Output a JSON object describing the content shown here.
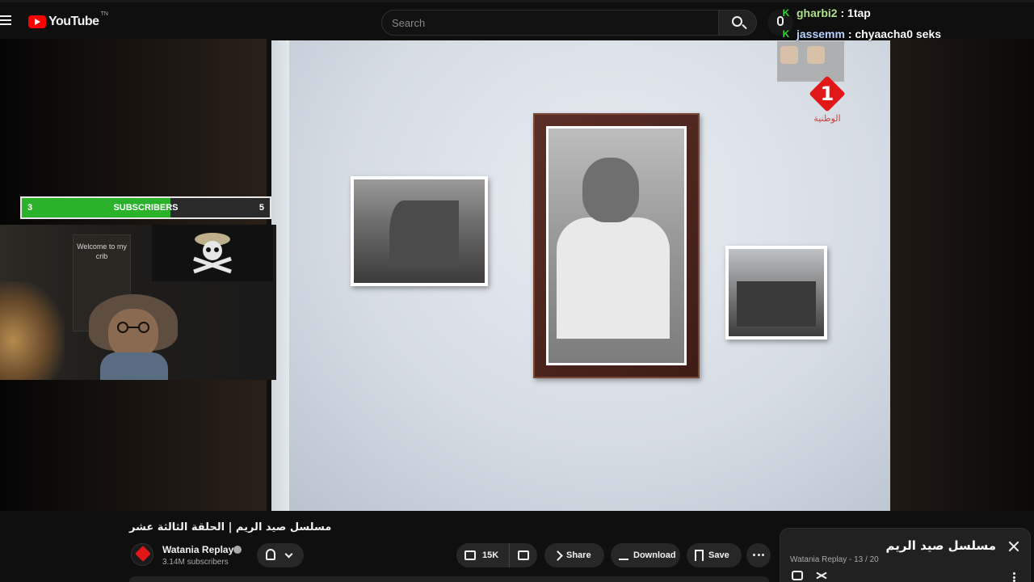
{
  "header": {
    "logo_text": "YouTube",
    "logo_tm": "TN",
    "search_placeholder": "Search"
  },
  "chat": {
    "messages": [
      {
        "user": "gharbi2",
        "sep": " : ",
        "text": "1tap"
      },
      {
        "user": "jassemm",
        "sep": " : ",
        "text": "chyaacha0 seks"
      }
    ]
  },
  "subscriber_bar": {
    "current": "3",
    "label": "SUBSCRIBERS",
    "goal": "5",
    "progress_fraction": 0.6
  },
  "webcam": {
    "poster_text": "Welcome to my crib"
  },
  "tv_overlay": {
    "channel_number": "1",
    "channel_caption": "الوطنية"
  },
  "video": {
    "title": "مسلسل صيد الريم | الحلقة الثالثة عشر",
    "channel_name": "Watania Replay",
    "subscribers": "3.14M subscribers",
    "like_count": "15K",
    "share_label": "Share",
    "download_label": "Download",
    "save_label": "Save"
  },
  "playlist": {
    "title": "مسلسل صيد الريم",
    "meta": "Watania Replay - 13 / 20"
  },
  "colors": {
    "brand_red": "#ff0000",
    "progress_green": "#29b22a",
    "chat_user_green": "#aee38f",
    "chat_user_blue": "#b8d3ff"
  }
}
